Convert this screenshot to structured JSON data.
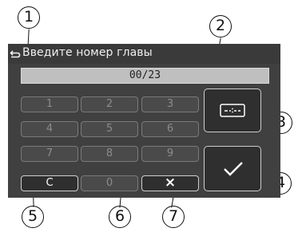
{
  "callouts": [
    "1",
    "2",
    "3",
    "4",
    "5",
    "6",
    "7"
  ],
  "title": "Введите номер главы",
  "display_value": "00/23",
  "keypad": {
    "rows": [
      [
        "1",
        "2",
        "3"
      ],
      [
        "4",
        "5",
        "6"
      ],
      [
        "7",
        "8",
        "9"
      ]
    ],
    "clear_label": "C",
    "zero_label": "0",
    "delete_label": "×"
  },
  "icons": {
    "back": "back-icon",
    "time_mode": "time-format-icon",
    "confirm": "check-icon",
    "delete": "close-icon"
  }
}
